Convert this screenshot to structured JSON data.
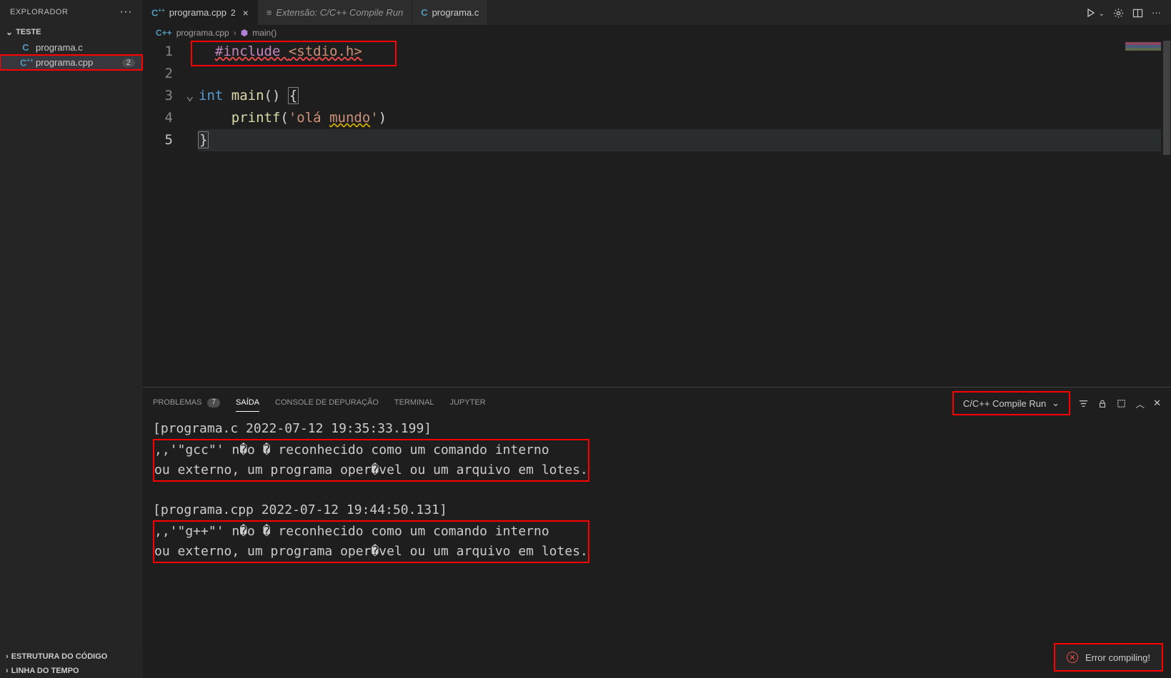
{
  "sidebar": {
    "title": "EXPLORADOR",
    "section": "TESTE",
    "items": [
      {
        "icon": "C",
        "label": "programa.c",
        "badge": ""
      },
      {
        "icon": "C++",
        "label": "programa.cpp",
        "badge": "2",
        "selected": true,
        "highlight": true
      }
    ],
    "bottom": [
      "ESTRUTURA DO CÓDIGO",
      "LINHA DO TEMPO"
    ]
  },
  "tabs": [
    {
      "icon": "C++",
      "label": "programa.cpp",
      "badge": "2",
      "active": true,
      "closeable": true
    },
    {
      "icon": "≡",
      "label": "Extensão: C/C++ Compile Run",
      "italic": true
    },
    {
      "icon": "C",
      "label": "programa.c"
    }
  ],
  "titlebar_actions": {
    "run": "▷",
    "gear": "⚙",
    "split": "▭",
    "more": "···"
  },
  "breadcrumbs": {
    "file_icon": "C++",
    "file": "programa.cpp",
    "symbol_icon": "⬢",
    "symbol": "main()"
  },
  "code": {
    "lines": [
      {
        "n": 1,
        "tokens": [
          {
            "t": "  ",
            "c": "punc"
          },
          {
            "t": "#include ",
            "c": "inc err"
          },
          {
            "t": "<stdio.h>",
            "c": "angle err"
          }
        ],
        "highlight_box": true
      },
      {
        "n": 2,
        "tokens": []
      },
      {
        "n": 3,
        "fold": true,
        "tokens": [
          {
            "t": "int",
            "c": "kw"
          },
          {
            "t": " ",
            "c": "punc"
          },
          {
            "t": "main",
            "c": "fn"
          },
          {
            "t": "() ",
            "c": "punc"
          },
          {
            "t": "{",
            "c": "punc cursor"
          }
        ]
      },
      {
        "n": 4,
        "tokens": [
          {
            "t": "    ",
            "c": "punc"
          },
          {
            "t": "printf",
            "c": "fn"
          },
          {
            "t": "(",
            "c": "punc"
          },
          {
            "t": "'olá ",
            "c": "str"
          },
          {
            "t": "mundo",
            "c": "str warn"
          },
          {
            "t": "'",
            "c": "str"
          },
          {
            "t": ")",
            "c": "punc"
          }
        ]
      },
      {
        "n": 5,
        "current": true,
        "hl": true,
        "tokens": [
          {
            "t": "}",
            "c": "punc cursor"
          }
        ]
      }
    ]
  },
  "panel": {
    "tabs": [
      {
        "label": "PROBLEMAS",
        "count": "7"
      },
      {
        "label": "SAÍDA",
        "active": true
      },
      {
        "label": "CONSOLE DE DEPURAÇÃO"
      },
      {
        "label": "TERMINAL"
      },
      {
        "label": "JUPYTER"
      }
    ],
    "task": "C/C++ Compile Run",
    "output": [
      {
        "header": "[programa.c 2022-07-12 19:35:33.199]",
        "lines": [
          ",,'\"gcc\"' n�o � reconhecido como um comando interno",
          "ou externo, um programa oper�vel ou um arquivo em lotes."
        ],
        "boxed": true
      },
      {
        "header": "[programa.cpp 2022-07-12 19:44:50.131]",
        "lines": [
          ",,'\"g++\"' n�o � reconhecido como um comando interno",
          "ou externo, um programa oper�vel ou um arquivo em lotes."
        ],
        "boxed": true
      }
    ],
    "toast": "Error compiling!"
  }
}
